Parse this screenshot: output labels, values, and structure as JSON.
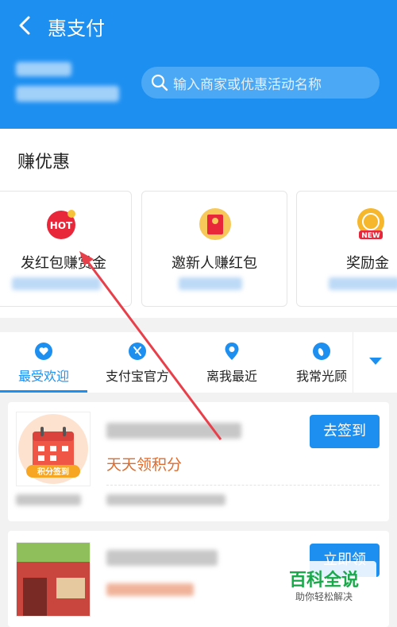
{
  "header": {
    "title": "惠支付",
    "search_placeholder": "输入商家或优惠活动名称"
  },
  "earn": {
    "title": "赚优惠",
    "cards": [
      {
        "label": "发红包赚赏金",
        "icon": "hot-badge-icon"
      },
      {
        "label": "邀新人赚红包",
        "icon": "red-envelope-icon"
      },
      {
        "label": "奖励金",
        "icon": "new-reward-icon"
      }
    ]
  },
  "tabs": {
    "items": [
      {
        "label": "最受欢迎",
        "icon": "heart-icon"
      },
      {
        "label": "支付宝官方",
        "icon": "alipay-icon"
      },
      {
        "label": "离我最近",
        "icon": "location-pin-icon"
      },
      {
        "label": "我常光顾",
        "icon": "footprint-icon"
      }
    ],
    "active_index": 0
  },
  "list": [
    {
      "action": "去签到",
      "tagline": "天天领积分",
      "thumb_label": "积分签到"
    },
    {
      "action": "立即领"
    }
  ],
  "watermark": {
    "title": "百科全说",
    "subtitle": "助你轻松解决"
  },
  "colors": {
    "primary": "#1d8ff0",
    "accent": "#e06b2c",
    "annotation": "#e8404a"
  }
}
